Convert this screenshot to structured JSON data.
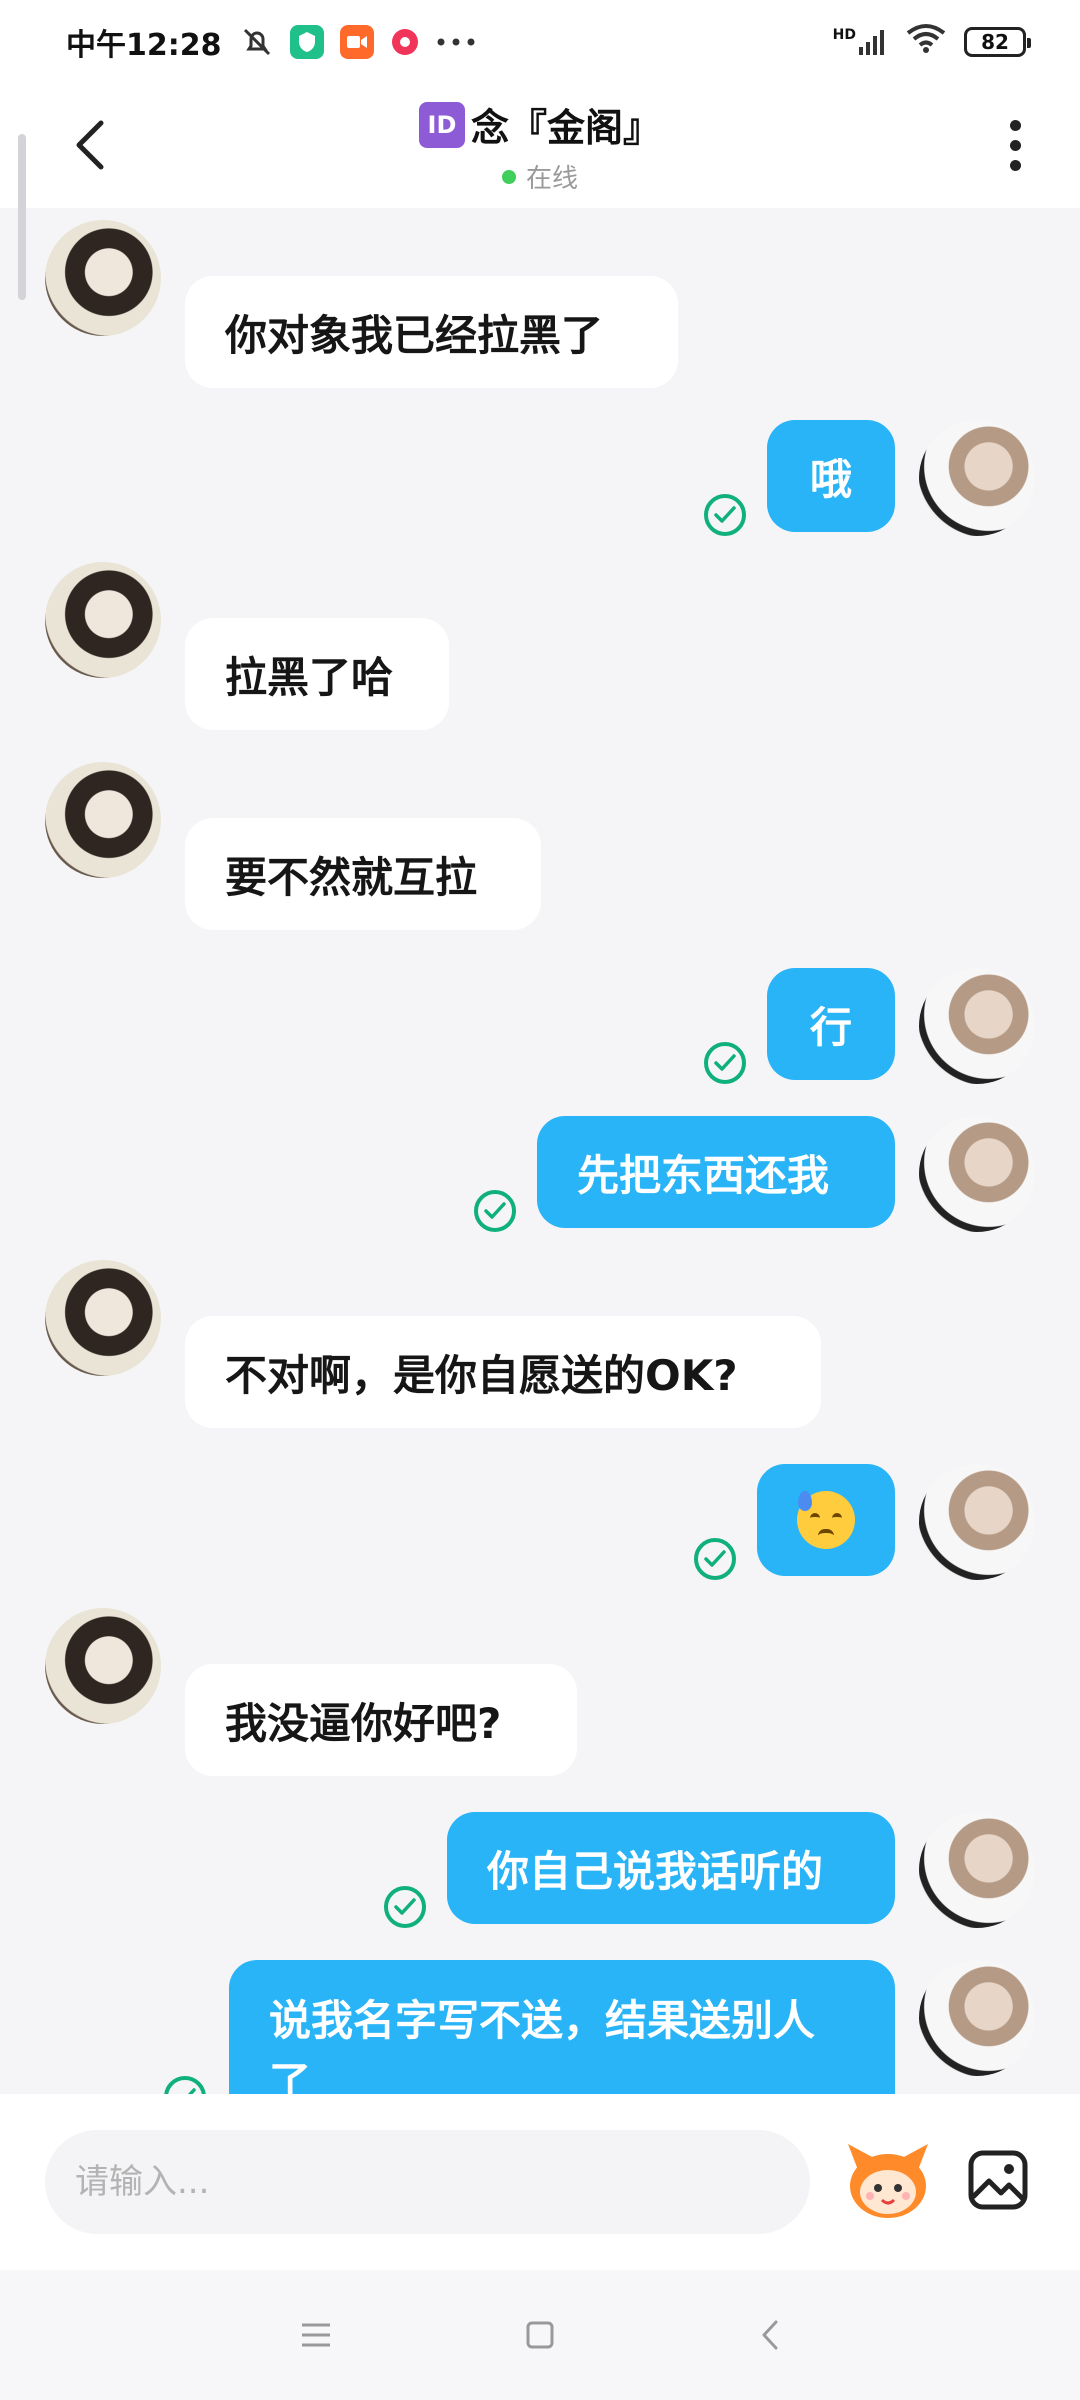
{
  "status_bar": {
    "time": "中午12:28",
    "network": "HD",
    "battery": "82"
  },
  "header": {
    "id_badge": "ID",
    "title": "念『金阁』",
    "status": "在线"
  },
  "messages": [
    {
      "side": "in",
      "text": "你对象我已经拉黑了"
    },
    {
      "side": "out",
      "text": "哦"
    },
    {
      "side": "in",
      "text": "拉黑了哈"
    },
    {
      "side": "in",
      "text": "要不然就互拉"
    },
    {
      "side": "out",
      "text": "行"
    },
    {
      "side": "out",
      "text": "先把东西还我"
    },
    {
      "side": "in",
      "text": "不对啊，是你自愿送的OK?"
    },
    {
      "side": "out",
      "emoji": "anxious-sweat-emoji"
    },
    {
      "side": "in",
      "text": "我没逼你好吧?"
    },
    {
      "side": "out",
      "text": "你自己说我话听的"
    },
    {
      "side": "out",
      "text": "说我名字写不送，结果送别人了"
    }
  ],
  "input": {
    "placeholder": "请输入..."
  },
  "colors": {
    "outgoing_bubble": "#28b4f7",
    "incoming_bubble": "#ffffff",
    "read_check": "#10b07a",
    "online_dot": "#3fcf5a"
  }
}
